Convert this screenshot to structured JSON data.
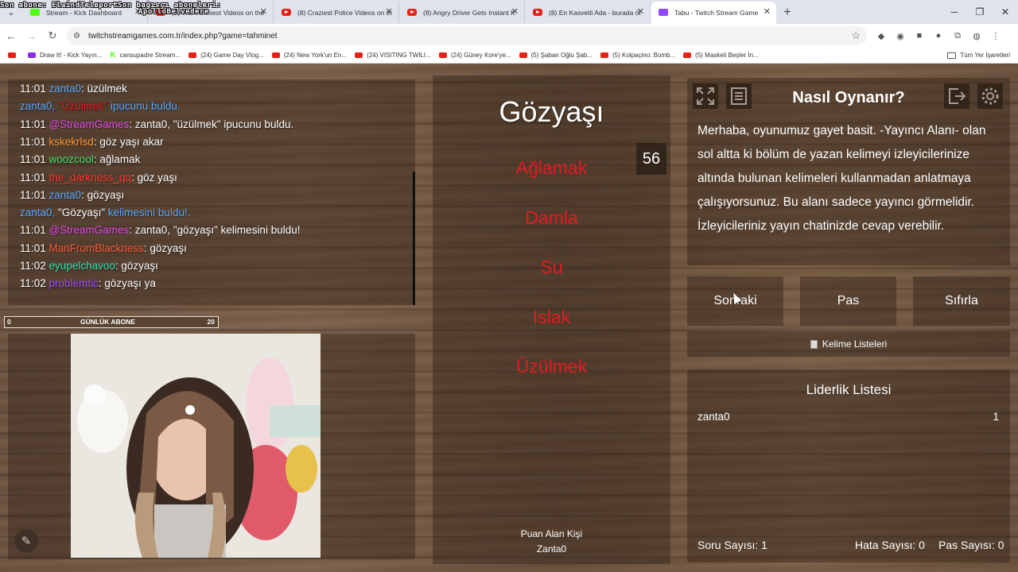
{
  "overlay": {
    "line1": "Son abone: ElwindTeleportSon bağışçı aboneleri:",
    "line2": "ApolloBelvedere"
  },
  "browser": {
    "tabs": [
      {
        "title": "Stream - Kick Dashboard",
        "favicon": "kick-icon",
        "active": false
      },
      {
        "title": "(8) The Funniest Videos on the",
        "favicon": "youtube-icon",
        "active": false
      },
      {
        "title": "(8) Craziest Police Videos on th",
        "favicon": "youtube-icon",
        "active": false
      },
      {
        "title": "(8) Angry Driver Gets Instant K",
        "favicon": "youtube-icon",
        "active": false
      },
      {
        "title": "(8) En Kasvetli Ada - burada öl",
        "favicon": "youtube-icon",
        "active": false
      },
      {
        "title": "Tabu - Twitch Stream Game",
        "favicon": "twitch-icon",
        "active": true
      }
    ],
    "url": "twitchstreamgames.com.tr/index.php?game=tahminet",
    "bookmarks": [
      {
        "label": "Draw It! - Kick Yayın...",
        "icon": "draw-icon"
      },
      {
        "label": "cansupadre Stream...",
        "icon": "kick-icon"
      },
      {
        "label": "(24) Game Day Vlog...",
        "icon": "youtube-icon"
      },
      {
        "label": "(24) New York'un En...",
        "icon": "youtube-icon"
      },
      {
        "label": "(24) VISITING TWILI...",
        "icon": "youtube-icon"
      },
      {
        "label": "(24) Güney Kore'ye...",
        "icon": "youtube-icon"
      },
      {
        "label": "(5) Şaban Oğlu Şab...",
        "icon": "youtube-icon"
      },
      {
        "label": "(5) Kolpaçino: Bomb...",
        "icon": "youtube-icon"
      },
      {
        "label": "(5) Maskeli Beşler İn...",
        "icon": "youtube-icon"
      }
    ],
    "all_bookmarks": "Tüm Yer İşaretleri"
  },
  "chat": {
    "messages": [
      {
        "time": "11:01",
        "user": "zanta0",
        "user_color": "#5aa9ff",
        "text": ": üzülmek"
      },
      {
        "time": "",
        "user": "",
        "user_color": "#5aa9ff",
        "system": true,
        "pre": "zanta0, ",
        "hl": "\"Üzülmek\"",
        "hl_color": "#e21b22",
        "post": " ipucunu buldu."
      },
      {
        "time": "11:01",
        "user": "@StreamGames",
        "user_color": "#e64ce8",
        "text": ": zanta0, \"üzülmek\" ipucunu buldu."
      },
      {
        "time": "11:01",
        "user": "kskekrlsd",
        "user_color": "#ff9a3c",
        "text": ": göz yaşı akar"
      },
      {
        "time": "11:01",
        "user": "woozcool",
        "user_color": "#3fe06a",
        "text": ": ağlamak"
      },
      {
        "time": "11:01",
        "user": "the_darkness_qq",
        "user_color": "#ff3b30",
        "text": ": göz yaşı"
      },
      {
        "time": "11:01",
        "user": "zanta0",
        "user_color": "#5aa9ff",
        "text": ": gözyaşı"
      },
      {
        "time": "",
        "user": "",
        "user_color": "#5aa9ff",
        "system": true,
        "pre": "zanta0, ",
        "hl": "\"Gözyaşı\"",
        "hl_color": "#ffffff",
        "post": " kelimesini buldu!."
      },
      {
        "time": "11:01",
        "user": "@StreamGames",
        "user_color": "#e64ce8",
        "text": ": zanta0, \"gözyaşı\" kelimesini buldu!"
      },
      {
        "time": "11:01",
        "user": "ManFromBlackness",
        "user_color": "#ff5a3c",
        "text": ": gözyaşı"
      },
      {
        "time": "11:02",
        "user": "eyupelchavoo",
        "user_color": "#38e0b0",
        "text": ": gözyaşı"
      },
      {
        "time": "11:02",
        "user": "problemtic",
        "user_color": "#a44cff",
        "text": ": gözyaşı ya"
      }
    ]
  },
  "subscriber_bar": {
    "min": "0",
    "label": "GÜNLÜK ABONE",
    "max": "20"
  },
  "game": {
    "timer": "56",
    "main_word": "Gözyaşı",
    "forbidden_words": [
      "Ağlamak",
      "Damla",
      "Su",
      "Islak",
      "Üzülmek"
    ],
    "scorer_label": "Puan Alan Kişi",
    "scorer_name": "Zanta0"
  },
  "howto": {
    "title": "Nasıl Oynanır?",
    "text": "Merhaba, oyunumuz gayet basit. -Yayıncı Alanı- olan sol altta ki bölüm de yazan kelimeyi izleyicilerinize altında bulunan kelimeleri kullanmadan anlatmaya çalışıyorsunuz. Bu alanı sadece yayıncı görmelidir. İzleyicileriniz yayın chatinizde cevap verebilir."
  },
  "controls": {
    "next": "Sonraki",
    "pass": "Pas",
    "reset": "Sıfırla",
    "word_lists": "Kelime Listeleri"
  },
  "leaderboard": {
    "title": "Liderlik Listesi",
    "entries": [
      {
        "name": "zanta0",
        "score": "1"
      }
    ]
  },
  "stats": {
    "questions": "Soru Sayısı: 1",
    "errors": "Hata Sayısı: 0",
    "passes": "Pas Sayısı: 0"
  }
}
